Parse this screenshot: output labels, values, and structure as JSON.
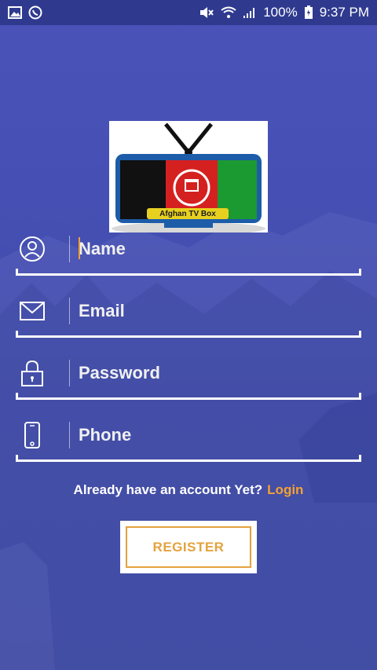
{
  "status_bar": {
    "battery": "100%",
    "time": "9:37 PM",
    "left_icons": [
      "image-icon",
      "whatsapp-icon"
    ],
    "right_icons": [
      "mute-icon",
      "wifi-icon",
      "signal-icon",
      "battery-icon"
    ]
  },
  "logo": {
    "text": "Afghan TV Box"
  },
  "form": {
    "name_placeholder": "Name",
    "email_placeholder": "Email",
    "password_placeholder": "Password",
    "phone_placeholder": "Phone"
  },
  "login_prompt": {
    "text": "Already have an account Yet?",
    "link": "Login"
  },
  "register_label": "REGISTER",
  "colors": {
    "background": "#4650b4",
    "status_bar": "#2f3a8f",
    "accent": "#f3a133"
  }
}
